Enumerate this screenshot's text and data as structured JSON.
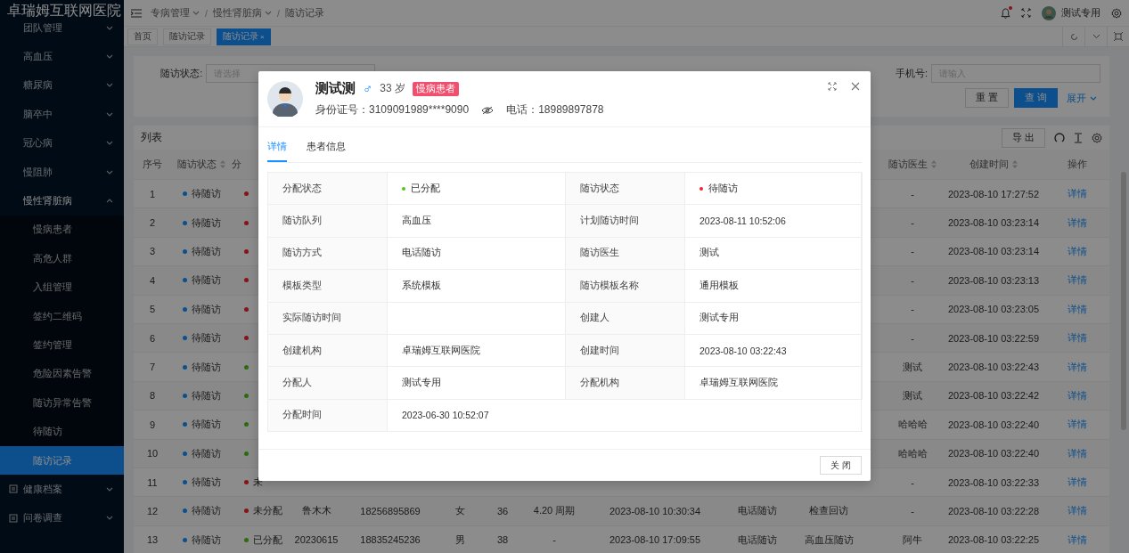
{
  "sidebar": {
    "title": "卓瑞姆互联网医院",
    "items": [
      {
        "label": "团队管理",
        "kind": "menu",
        "expanded": false
      },
      {
        "label": "高血压",
        "kind": "menu",
        "expanded": false
      },
      {
        "label": "糖尿病",
        "kind": "menu",
        "expanded": false
      },
      {
        "label": "脑卒中",
        "kind": "menu",
        "expanded": false
      },
      {
        "label": "冠心病",
        "kind": "menu",
        "expanded": false
      },
      {
        "label": "慢阻肺",
        "kind": "menu",
        "expanded": false
      },
      {
        "label": "慢性肾脏病",
        "kind": "menu",
        "expanded": true,
        "children": [
          {
            "label": "慢病患者",
            "selected": false
          },
          {
            "label": "高危人群",
            "selected": false
          },
          {
            "label": "入组管理",
            "selected": false
          },
          {
            "label": "签约二维码",
            "selected": false
          },
          {
            "label": "签约管理",
            "selected": false
          },
          {
            "label": "危险因素告警",
            "selected": false
          },
          {
            "label": "随访异常告警",
            "selected": false
          },
          {
            "label": "待随访",
            "selected": false
          },
          {
            "label": "随访记录",
            "selected": true
          }
        ]
      },
      {
        "label": "健康档案",
        "kind": "menu_icon",
        "expanded": false
      },
      {
        "label": "问卷调查",
        "kind": "menu_icon",
        "expanded": false
      }
    ]
  },
  "header": {
    "breadcrumb": [
      {
        "label": "专病管理",
        "dropdown": true,
        "separator": "/"
      },
      {
        "label": "慢性肾脏病",
        "dropdown": true,
        "separator": "/"
      },
      {
        "label": "随访记录",
        "dropdown": false
      }
    ],
    "user": {
      "name": "测试专用",
      "notification": true
    }
  },
  "nav_tabs": [
    {
      "label": "首页",
      "selected": false
    },
    {
      "label": "随访记录",
      "selected": false
    },
    {
      "label": "随访记录",
      "selected": true,
      "close": "×"
    }
  ],
  "filter": {
    "fields": [
      {
        "label": "随访状态:",
        "placeholder": "请选择",
        "kind": "select"
      },
      {
        "label": "手机号:",
        "placeholder": "请输入",
        "kind": "input"
      }
    ],
    "reset": "重 置",
    "search": "查 询",
    "expand": "展开"
  },
  "table": {
    "title": "列表",
    "export": "导 出",
    "headers": {
      "seq": {
        "label": "序号"
      },
      "follow_status": {
        "label": "随访状态",
        "sortable": true
      },
      "alloc_status": {
        "label": "分"
      },
      "doctor": {
        "label": "随访医生",
        "sortable": true
      },
      "created": {
        "label": "创建时间",
        "sortable": true
      },
      "action": {
        "label": "操作"
      }
    },
    "rows": [
      {
        "seq": "1",
        "follow_status": {
          "text": "待随访",
          "color": "#0d4f8c"
        },
        "alloc_status": {
          "color": "#871319"
        },
        "doctor": "-",
        "created": "2023-08-10 17:27:52",
        "action": "详情"
      },
      {
        "seq": "2",
        "follow_status": {
          "text": "待随访",
          "color": "#0d4f8c"
        },
        "alloc_status": {
          "color": "#871319"
        },
        "doctor": "-",
        "created": "2023-08-10 03:23:14",
        "action": "详情"
      },
      {
        "seq": "3",
        "follow_status": {
          "text": "待随访",
          "color": "#0d4f8c"
        },
        "alloc_status": {
          "color": "#871319"
        },
        "doctor": "-",
        "created": "2023-08-10 03:23:14",
        "action": "详情"
      },
      {
        "seq": "4",
        "follow_status": {
          "text": "待随访",
          "color": "#0d4f8c"
        },
        "alloc_status": {
          "color": "#871319"
        },
        "doctor": "-",
        "created": "2023-08-10 03:23:13",
        "action": "详情"
      },
      {
        "seq": "5",
        "follow_status": {
          "text": "待随访",
          "color": "#0d4f8c"
        },
        "alloc_status": {
          "color": "#871319"
        },
        "doctor": "-",
        "created": "2023-08-10 03:23:05",
        "action": "详情"
      },
      {
        "seq": "6",
        "follow_status": {
          "text": "待随访",
          "color": "#0d4f8c"
        },
        "alloc_status": {
          "color": "#871319"
        },
        "doctor": "-",
        "created": "2023-08-10 03:22:59",
        "action": "详情"
      },
      {
        "seq": "7",
        "follow_status": {
          "text": "待随访",
          "color": "#0d4f8c"
        },
        "alloc_status": {
          "color": "#2d6c0e"
        },
        "doctor": "测试",
        "created": "2023-08-10 03:22:43",
        "action": "详情"
      },
      {
        "seq": "8",
        "follow_status": {
          "text": "待随访",
          "color": "#0d4f8c"
        },
        "alloc_status": {
          "color": "#2d6c0e"
        },
        "doctor": "测试",
        "created": "2023-08-10 03:22:42",
        "action": "详情"
      },
      {
        "seq": "9",
        "follow_status": {
          "text": "待随访",
          "color": "#0d4f8c"
        },
        "alloc_status": {
          "color": "#2d6c0e"
        },
        "doctor": "哈哈哈",
        "created": "2023-08-10 03:22:40",
        "action": "详情"
      },
      {
        "seq": "10",
        "follow_status": {
          "text": "待随访",
          "color": "#0d4f8c"
        },
        "alloc_status": {
          "color": "#2d6c0e"
        },
        "doctor": "哈哈哈",
        "created": "2023-08-10 03:22:40",
        "action": "详情"
      },
      {
        "seq": "11",
        "follow_status": {
          "text": "待随访",
          "color": "#0d4f8c"
        },
        "alloc_status": {
          "text": "未",
          "color": "#871319"
        },
        "doctor": "-",
        "created": "2023-08-10 03:22:33",
        "action": "详情"
      },
      {
        "seq": "12",
        "follow_status": {
          "text": "待随访",
          "color": "#0d4f8c"
        },
        "alloc_status": {
          "text": "未分配",
          "color": "#871319"
        },
        "name": "鲁木木",
        "phone": "18256895869",
        "gender": "女",
        "age": "36",
        "cycle": "4.20 周期",
        "visit_time": "2023-08-10 10:30:34",
        "method": "电话随访",
        "template": "检查回访",
        "doctor": "-",
        "created": "2023-08-10 03:22:28",
        "action": "详情"
      },
      {
        "seq": "13",
        "follow_status": {
          "text": "待随访",
          "color": "#0d4f8c"
        },
        "alloc_status": {
          "text": "已分配",
          "color": "#2d6c0e"
        },
        "name": "20230615",
        "phone": "18835245236",
        "gender": "男",
        "age": "38",
        "cycle": "-",
        "visit_time": "2023-08-10 17:09:55",
        "method": "电话随访",
        "template": "高血压随访",
        "doctor": "阿牛",
        "created": "2023-08-10 03:22:25",
        "action": "详情"
      }
    ]
  },
  "modal": {
    "name": "测试测",
    "gender_symbol": "♂",
    "age": "33 岁",
    "tag": "慢病患者",
    "id_label": "身份证号：3109091989****9090",
    "phone": "电话：18989897878",
    "tabs": [
      {
        "label": "详情",
        "selected": true
      },
      {
        "label": "患者信息",
        "selected": false
      }
    ],
    "details": [
      [
        {
          "label": "分配状态",
          "value": "已分配",
          "color": "#52c41a"
        },
        {
          "label": "随访状态",
          "value": "待随访",
          "color": "#f5222d"
        }
      ],
      [
        {
          "label": "随访队列",
          "value": "高血压"
        },
        {
          "label": "计划随访时间",
          "value": "2023-08-11 10:52:06"
        }
      ],
      [
        {
          "label": "随访方式",
          "value": "电话随访"
        },
        {
          "label": "随访医生",
          "value": "测试"
        }
      ],
      [
        {
          "label": "模板类型",
          "value": "系统模板"
        },
        {
          "label": "随访模板名称",
          "value": "通用模板"
        }
      ],
      [
        {
          "label": "实际随访时间"
        },
        {
          "label": "创建人",
          "value": "测试专用"
        }
      ],
      [
        {
          "label": "创建机构",
          "value": "卓瑞姆互联网医院"
        },
        {
          "label": "创建时间",
          "value": "2023-08-10 03:22:43"
        }
      ],
      [
        {
          "label": "分配人",
          "value": "测试专用"
        },
        {
          "label": "分配机构",
          "value": "卓瑞姆互联网医院"
        }
      ],
      [
        {
          "label": "分配时间",
          "value": "2023-06-30 10:52:07"
        }
      ]
    ],
    "close_button": "关 闭"
  }
}
